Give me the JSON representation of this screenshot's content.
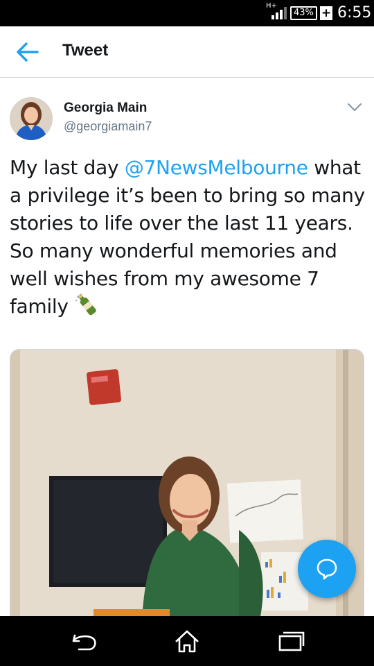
{
  "status_bar": {
    "network_type": "H+",
    "battery": "43%",
    "charging": "+",
    "time": "6:55"
  },
  "header": {
    "back_icon": "arrow-left-icon",
    "title": "Tweet"
  },
  "tweet": {
    "author_name": "Georgia Main",
    "author_handle": "@georgiamain7",
    "more_icon": "chevron-down-icon",
    "text_segments": [
      "My last day ",
      "@7NewsMelbourne",
      " what a privilege it’s been to bring so many stories to life over the last 11 years. So many wonderful memories and well wishes from my awesome 7 family "
    ],
    "emoji_icon": "champagne-bottle-icon",
    "photo_description_icon": "tweet-photo"
  },
  "fab": {
    "icon": "reply-bubble-icon"
  },
  "nav_bar": {
    "buttons": [
      "back-icon",
      "home-icon",
      "recents-icon"
    ]
  },
  "colors": {
    "accent": "#1da1f2",
    "text": "#14171a",
    "secondary_text": "#657786"
  }
}
